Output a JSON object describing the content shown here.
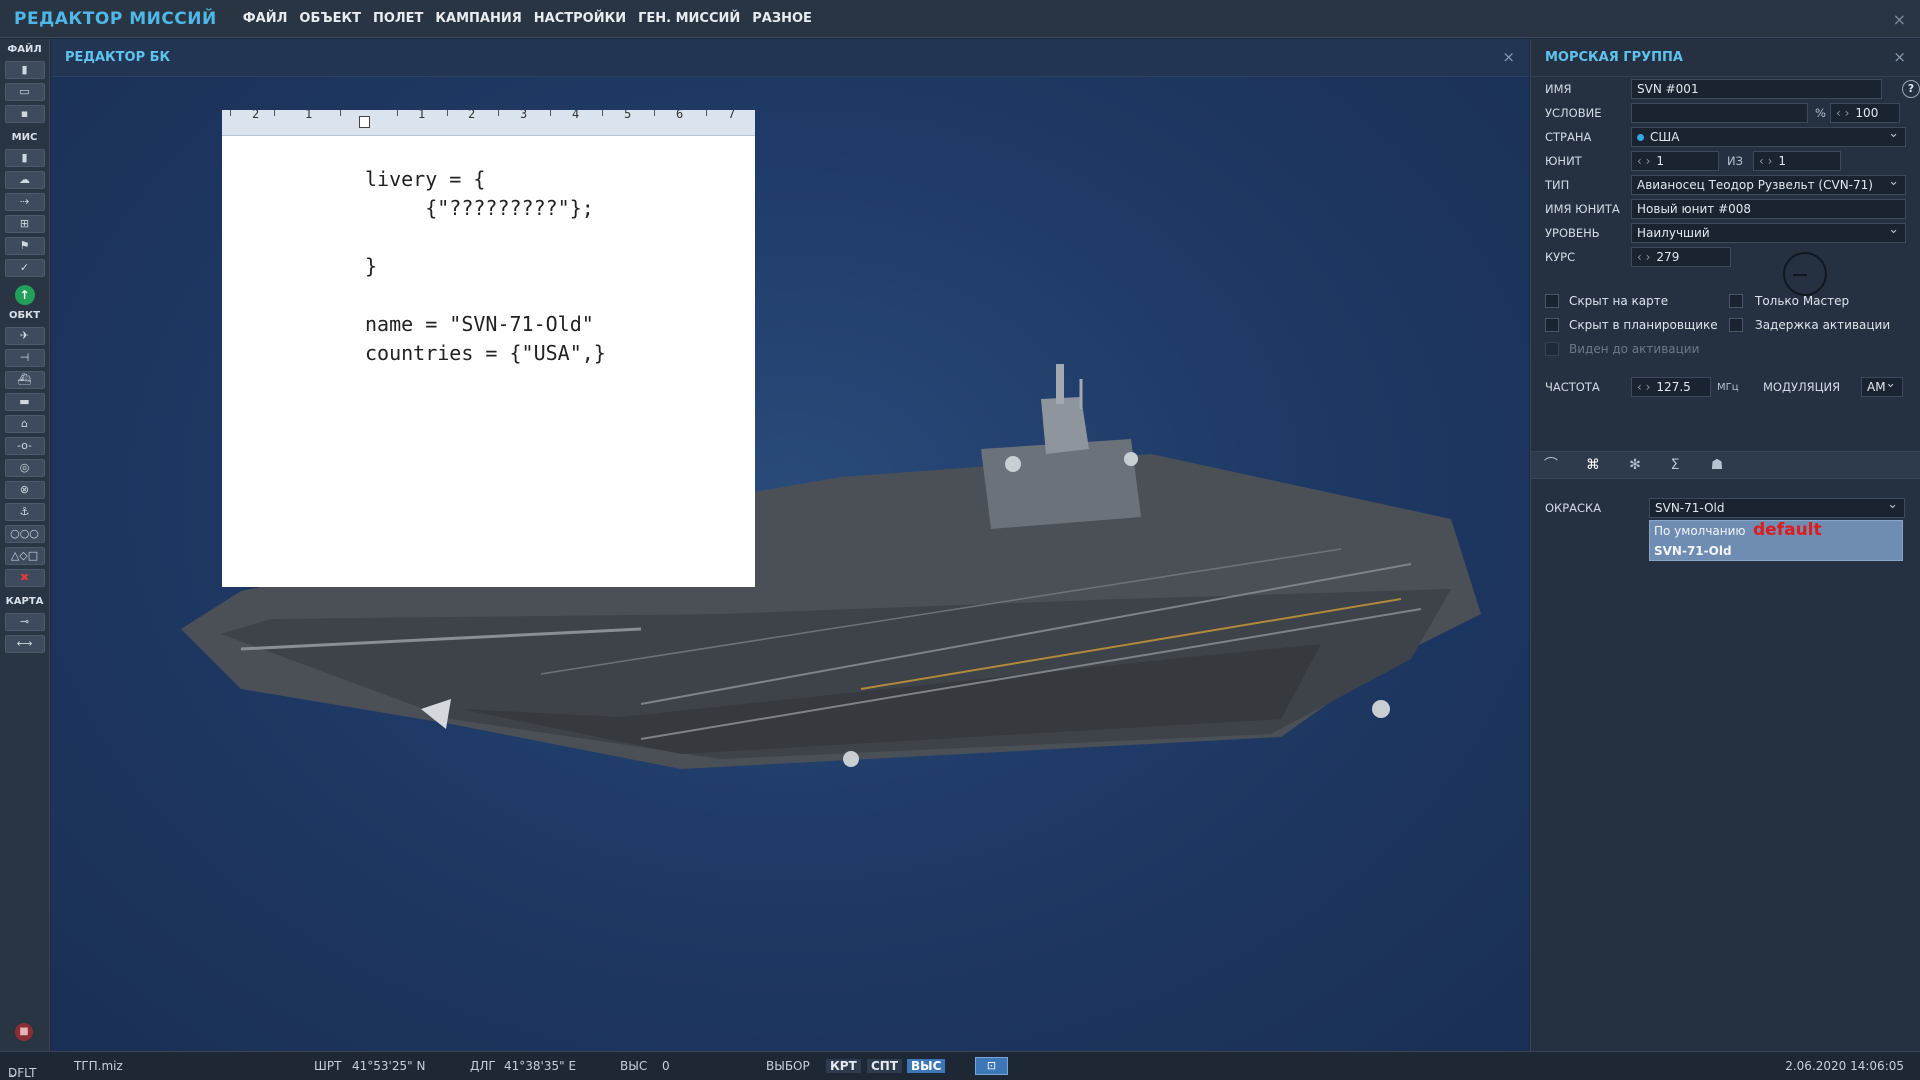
{
  "app": {
    "title": "РЕДАКТОР МИССИЙ",
    "menu": [
      "ФАЙЛ",
      "ОБЪЕКТ",
      "ПОЛЕТ",
      "КАМПАНИЯ",
      "НАСТРОЙКИ",
      "ГЕН. МИССИЙ",
      "РАЗНОЕ"
    ],
    "close": "×"
  },
  "toolbar": {
    "sections": [
      "ФАЙЛ",
      "МИС",
      "ОБКТ",
      "КАРТА"
    ]
  },
  "editor": {
    "title": "РЕДАКТОР БК",
    "close": "×",
    "ruler": [
      "2",
      "1",
      "1",
      "2",
      "3",
      "4",
      "5",
      "6",
      "7"
    ],
    "code": "livery = {\n     {\"?????????\"};\n\n}\n\nname = \"SVN-71-Old\"\ncountries = {\"USA\",}"
  },
  "panel": {
    "title": "МОРСКАЯ ГРУППА",
    "close": "×",
    "name_label": "ИМЯ",
    "name_value": "SVN #001",
    "help": "?",
    "condition_label": "УСЛОВИЕ",
    "condition_value": "",
    "condition_pct": "%",
    "condition_num": "100",
    "country_label": "СТРАНА",
    "country_value": "США",
    "unit_label": "ЮНИТ",
    "unit_value": "1",
    "unit_of": "ИЗ",
    "unit_total": "1",
    "type_label": "ТИП",
    "type_value": "Авианосец Теодор Рузвельт (CVN-71)",
    "unit_name_label": "ИМЯ ЮНИТА",
    "unit_name_value": "Новый юнит #008",
    "level_label": "УРОВЕНЬ",
    "level_value": "Наилучший",
    "course_label": "КУРС",
    "course_value": "279",
    "check_hidden_map": "Скрыт на карте",
    "check_master_only": "Только Мастер",
    "check_hidden_planner": "Скрыт в планировщике",
    "check_activation_delay": "Задержка активации",
    "check_visible_before": "Виден до активации",
    "freq_label": "ЧАСТОТА",
    "freq_value": "127.5",
    "freq_unit": "МГц",
    "modulation_label": "МОДУЛЯЦИЯ",
    "modulation_value": "AM",
    "livery_label": "ОКРАСКА",
    "livery_value": "SVN-71-Old",
    "livery_options": [
      "По умолчанию",
      "SVN-71-Old"
    ],
    "default_note": "default"
  },
  "status": {
    "preset": "DFLT",
    "file": "ТГП.miz",
    "lat_label": "ШРТ",
    "lat_value": "41°53'25\" N",
    "lon_label": "ДЛГ",
    "lon_value": "41°38'35\" E",
    "alt_label": "ВЫС",
    "alt_value": "0",
    "select_label": "ВЫБОР",
    "btn_krt": "КРТ",
    "btn_spt": "СПТ",
    "btn_vys": "ВЫС",
    "datetime": "2.06.2020 14:06:05"
  }
}
